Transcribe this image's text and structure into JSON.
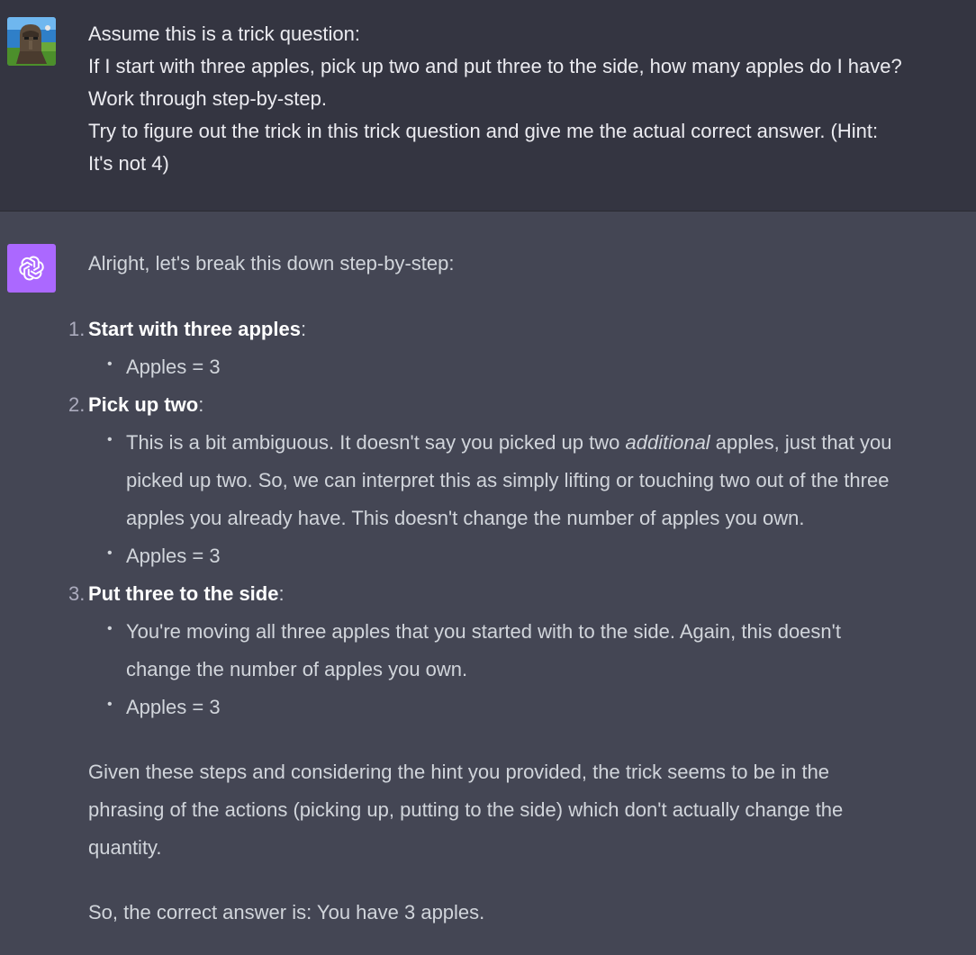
{
  "user_message": {
    "lines": [
      "Assume this is a trick question:",
      "If I start with three apples, pick up two and put three to the side, how many apples do I have?",
      "Work through step-by-step.",
      "Try to figure out the trick in this trick question and give me the actual correct answer. (Hint:",
      "It's not 4)"
    ]
  },
  "assistant_message": {
    "avatar_icon": "openai-logo-icon",
    "avatar_color": "#ab68ff",
    "intro": "Alright, let's break this down step-by-step:",
    "steps": [
      {
        "number": "1.",
        "title": "Start with three apples",
        "suffix": ":",
        "bullets": [
          "Apples = 3"
        ]
      },
      {
        "number": "2.",
        "title": "Pick up two",
        "suffix": ":",
        "bullet_ambiguous": {
          "before": "This is a bit ambiguous. It doesn't say you picked up two ",
          "emphasis": "additional",
          "after_line1": " apples, just that you",
          "line2": "picked up two. So, we can interpret this as simply lifting or touching two out of the three",
          "line3": "apples you already have. This doesn't change the number of apples you own."
        },
        "bullets": [
          "Apples = 3"
        ]
      },
      {
        "number": "3.",
        "title": "Put three to the side",
        "suffix": ":",
        "bullet_moving": {
          "line1": "You're moving all three apples that you started with to the side. Again, this doesn't",
          "line2": "change the number of apples you own."
        },
        "bullets": [
          "Apples = 3"
        ]
      }
    ],
    "conclusion_lines": [
      "Given these steps and considering the hint you provided, the trick seems to be in the",
      "phrasing of the actions (picking up, putting to the side) which don't actually change the",
      "quantity."
    ],
    "final_answer": "So, the correct answer is: You have 3 apples."
  }
}
